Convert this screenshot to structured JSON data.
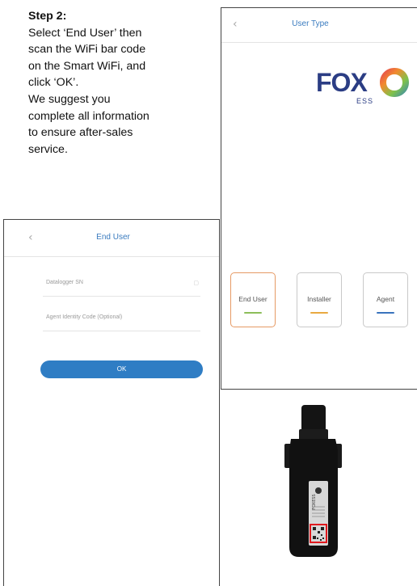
{
  "instructions": {
    "step_title": "Step 2:",
    "lines": [
      "Select ‘End User’ then",
      "scan the WiFi bar code",
      "on the Smart WiFi, and",
      "click ‘OK’.",
      "We suggest you",
      "complete all information",
      "to ensure after-sales",
      "service."
    ]
  },
  "user_type_screen": {
    "title": "User Type",
    "logo_text": "FOX",
    "logo_subtext": "ESS",
    "options": [
      {
        "label": "End User",
        "selected": true,
        "line_color": "#8dbe5a"
      },
      {
        "label": "Installer",
        "selected": false,
        "line_color": "#e9a940"
      },
      {
        "label": "Agent",
        "selected": false,
        "line_color": "#3a73bd"
      }
    ],
    "selected_border_color": "#e69a65"
  },
  "end_user_screen": {
    "title": "End User",
    "fields": [
      {
        "label": "Datalogger SN"
      },
      {
        "label": "Agent Identity Code (Optional)"
      }
    ],
    "ok_label": "OK",
    "accent_color": "#2f7dc4"
  },
  "device": {
    "brand_text": "FOXESS"
  }
}
